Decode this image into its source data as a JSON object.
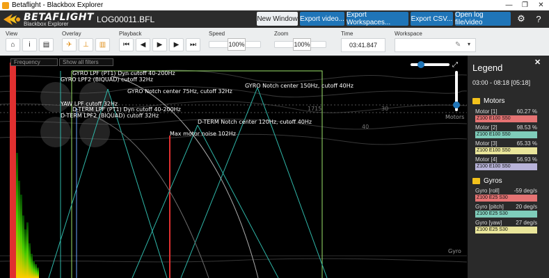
{
  "window": {
    "title": "Betaflight - Blackbox Explorer",
    "min": "—",
    "max": "❐",
    "close": "✕"
  },
  "header": {
    "brand": "BETAFLIGHT",
    "brand_sub": "Blackbox Explorer",
    "filename": "LOG00011.BFL",
    "buttons": {
      "new_window": "New Window",
      "export_video": "Export video...",
      "export_workspaces": "Export Workspaces...",
      "export_csv": "Export CSV...",
      "open_log": "Open log file/video"
    }
  },
  "toolbar": {
    "view_label": "View",
    "overlay_label": "Overlay",
    "playback_label": "Playback",
    "speed_label": "Speed",
    "speed_value": "100%",
    "zoom_label": "Zoom",
    "zoom_value": "100%",
    "time_label": "Time",
    "time_value": "03:41.847",
    "workspace_label": "Workspace"
  },
  "analyser": {
    "frequency_placeholder": "Frequency",
    "filter_placeholder": "Show all filters",
    "annotations": [
      "GYRO LPF (PT1) Dyn cutoff 40-200Hz",
      "GYRO LPF2 (BIQUAD) cutoff 32Hz",
      "GYRO Notch center 75Hz, cutoff 32Hz",
      "GYRO Notch center 150Hz, cutoff 40Hz",
      "YAW LPF cutoff 32Hz",
      "D-TERM LPF (PT1) Dyn cutoff 40-200Hz",
      "D-TERM LPF2 (BIQUAD) cutoff 32Hz",
      "D-TERM Notch center 120Hz, cutoff 40Hz",
      "Max motor noise 102Hz"
    ],
    "bg_labels": {
      "rpm": "1715",
      "n30": "30",
      "n40": "40",
      "motors": "Motors",
      "gyro": "Gyro"
    }
  },
  "legend": {
    "title": "Legend",
    "range": "03:00 - 08:18 [05:18]",
    "groups": [
      {
        "name": "Motors",
        "series": [
          {
            "label": "Motor [1]",
            "value": "60.27 %",
            "tag": "Z100 E100 S50",
            "color": "#e57373"
          },
          {
            "label": "Motor [2]",
            "value": "98.53 %",
            "tag": "Z100 E100 S50",
            "color": "#7fcdbb"
          },
          {
            "label": "Motor [3]",
            "value": "65.33 %",
            "tag": "Z100 E100 S50",
            "color": "#e9e59a"
          },
          {
            "label": "Motor [4]",
            "value": "56.93 %",
            "tag": "Z100 E100 S50",
            "color": "#b8b3d9"
          }
        ]
      },
      {
        "name": "Gyros",
        "series": [
          {
            "label": "Gyro [roll]",
            "value": "-59 deg/s",
            "tag": "Z100 E25 S30",
            "color": "#e57373"
          },
          {
            "label": "Gyro [pitch]",
            "value": "20 deg/s",
            "tag": "Z100 E25 S30",
            "color": "#7fcdbb"
          },
          {
            "label": "Gyro [yaw]",
            "value": "27 deg/s",
            "tag": "Z100 E25 S30",
            "color": "#e9e59a"
          }
        ]
      }
    ]
  },
  "colors": {
    "header": "#2c2c2c",
    "accent": "#1f75b8",
    "toolbar": "#eceeef",
    "legend_bg": "#2a2a2a",
    "folder": "#f3c21c"
  }
}
